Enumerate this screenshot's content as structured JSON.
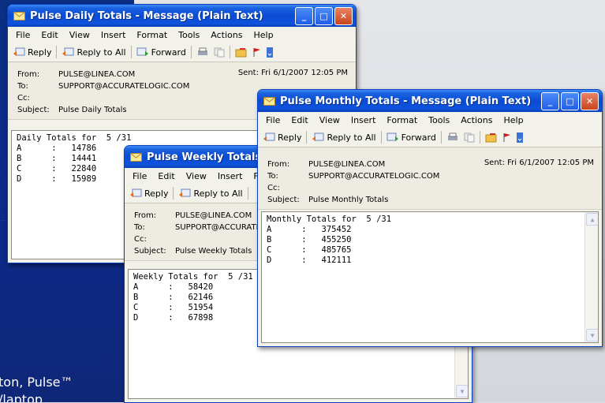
{
  "desktop": {
    "line1": "ton, Pulse™",
    "line2": "/laptop"
  },
  "menu": [
    "File",
    "Edit",
    "View",
    "Insert",
    "Format",
    "Tools",
    "Actions",
    "Help"
  ],
  "toolbar": {
    "reply": "Reply",
    "reply_all": "Reply to All",
    "forward": "Forward"
  },
  "labels": {
    "from": "From:",
    "to": "To:",
    "cc": "Cc:",
    "subject": "Subject:",
    "sent": "Sent:"
  },
  "daily": {
    "title": "Pulse Daily Totals - Message (Plain Text)",
    "from": "PULSE@LINEA.COM",
    "to": "SUPPORT@ACCURATELOGIC.COM",
    "cc": "",
    "subject": "Pulse Daily Totals",
    "sent": "Fri 6/1/2007 12:05 PM",
    "body": "Daily Totals for  5 /31\nA      :   14786\nB      :   14441\nC      :   22840\nD      :   15989"
  },
  "weekly": {
    "title": "Pulse Weekly Totals - Message (Plain Text)",
    "from": "PULSE@LINEA.COM",
    "to": "SUPPORT@ACCURATELOGIC.COM",
    "cc": "",
    "subject": "Pulse Weekly Totals",
    "body": "Weekly Totals for  5 /31\nA      :   58420\nB      :   62146\nC      :   51954\nD      :   67898"
  },
  "monthly": {
    "title": "Pulse Monthly Totals - Message (Plain Text)",
    "from": "PULSE@LINEA.COM",
    "to": "SUPPORT@ACCURATELOGIC.COM",
    "cc": "",
    "subject": "Pulse Monthly Totals",
    "sent": "Fri 6/1/2007 12:05 PM",
    "body": "Monthly Totals for  5 /31\nA      :   375452\nB      :   455250\nC      :   485765\nD      :   412111"
  },
  "colors": {
    "titlebar": "#0a4bd4",
    "desktop_blue": "#0d2a8a",
    "window_bg": "#f3f2ea"
  }
}
